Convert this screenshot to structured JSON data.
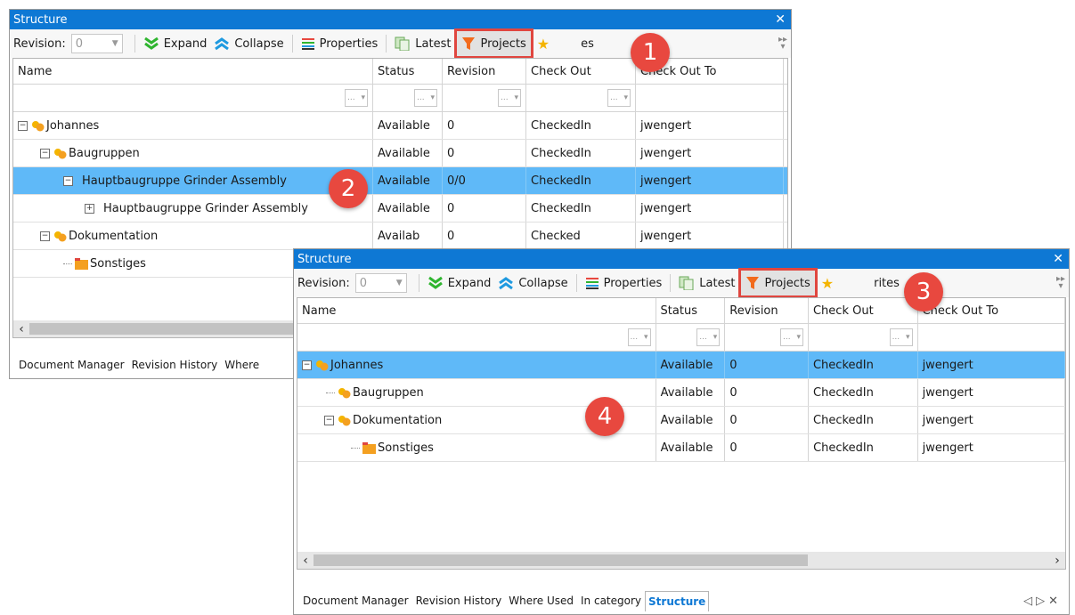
{
  "panel1": {
    "title": "Structure",
    "toolbar": {
      "revision_label": "Revision:",
      "revision_value": "0",
      "expand": "Expand",
      "collapse": "Collapse",
      "properties": "Properties",
      "latest": "Latest",
      "projects": "Projects",
      "favorites_partial": "es"
    },
    "columns": [
      "Name",
      "Status",
      "Revision",
      "Check Out",
      "Check Out To"
    ],
    "filter_ellipsis": "...",
    "rows": [
      {
        "name": "Johannes",
        "status": "Available",
        "revision": "0",
        "checkout": "CheckedIn",
        "checkout_to": "jwengert"
      },
      {
        "name": "Baugruppen",
        "status": "Available",
        "revision": "0",
        "checkout": "CheckedIn",
        "checkout_to": "jwengert"
      },
      {
        "name": "Hauptbaugruppe Grinder Assembly",
        "status": "Available",
        "revision": "0/0",
        "checkout": "CheckedIn",
        "checkout_to": "jwengert"
      },
      {
        "name": "Hauptbaugruppe Grinder Assembly",
        "status": "Available",
        "revision": "0",
        "checkout": "CheckedIn",
        "checkout_to": "jwengert"
      },
      {
        "name": "Dokumentation",
        "status": "Availab",
        "revision": "0",
        "checkout": "Checked",
        "checkout_to": "jwengert"
      },
      {
        "name": "Sonstiges",
        "status": "",
        "revision": "",
        "checkout": "",
        "checkout_to": ""
      }
    ],
    "tabs": [
      "Document Manager",
      "Revision History",
      "Where"
    ]
  },
  "panel2": {
    "title": "Structure",
    "toolbar": {
      "revision_label": "Revision:",
      "revision_value": "0",
      "expand": "Expand",
      "collapse": "Collapse",
      "properties": "Properties",
      "latest": "Latest",
      "projects": "Projects",
      "favorites_partial": "rites"
    },
    "columns": [
      "Name",
      "Status",
      "Revision",
      "Check Out",
      "Check Out To"
    ],
    "filter_ellipsis": "...",
    "rows": [
      {
        "name": "Johannes",
        "status": "Available",
        "revision": "0",
        "checkout": "CheckedIn",
        "checkout_to": "jwengert"
      },
      {
        "name": "Baugruppen",
        "status": "Available",
        "revision": "0",
        "checkout": "CheckedIn",
        "checkout_to": "jwengert"
      },
      {
        "name": "Dokumentation",
        "status": "Available",
        "revision": "0",
        "checkout": "CheckedIn",
        "checkout_to": "jwengert"
      },
      {
        "name": "Sonstiges",
        "status": "Available",
        "revision": "0",
        "checkout": "CheckedIn",
        "checkout_to": "jwengert"
      }
    ],
    "tabs": [
      "Document Manager",
      "Revision History",
      "Where Used",
      "In category",
      "Structure"
    ]
  },
  "callouts": [
    "1",
    "2",
    "3",
    "4"
  ],
  "colors": {
    "titlebar": "#0e78d4",
    "selected_row": "#5fb9f8",
    "highlight_border": "#e0463f",
    "callout": "#e8483f",
    "projects_filter_icon": "#f26b1d",
    "expand_icon": "#2fb52f",
    "collapse_icon": "#1f9ae0"
  },
  "icons": [
    "funnel-icon",
    "chevron-double-down-icon",
    "chevron-double-up-icon",
    "list-lines-icon",
    "copy-pages-icon",
    "star-add-icon",
    "project-node-icon",
    "folder-node-icon",
    "close-icon"
  ]
}
